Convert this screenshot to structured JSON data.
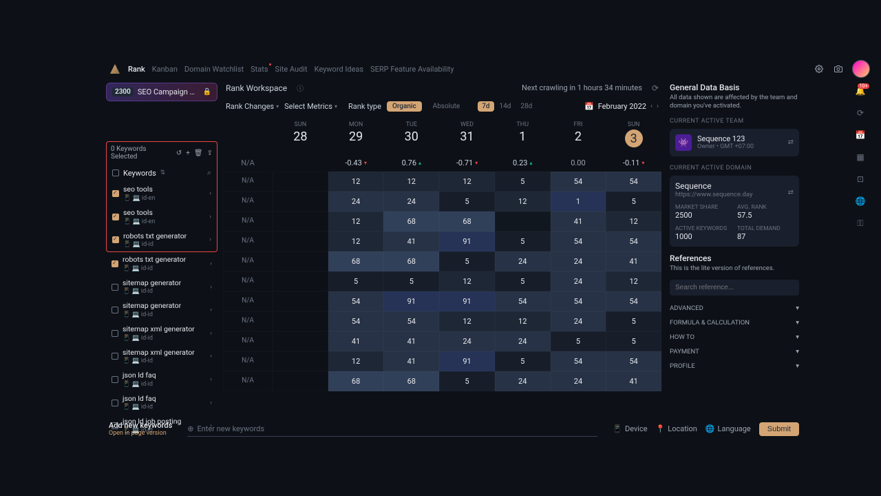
{
  "nav": {
    "items": [
      "Rank",
      "Kanban",
      "Domain Watchlist",
      "Stats",
      "Site Audit",
      "Keyword Ideas",
      "SERP Feature Availability"
    ],
    "active": 0
  },
  "project": {
    "count": "2300",
    "name": "SEO Campaign M.."
  },
  "kw_panel": {
    "selected_label": "0 Keywords Selected",
    "header": "Keywords",
    "items": [
      {
        "name": "seo tools",
        "meta": "id-en",
        "checked": true
      },
      {
        "name": "seo tools",
        "meta": "id-en",
        "checked": true
      },
      {
        "name": "robots txt generator",
        "meta": "id-id",
        "checked": true
      },
      {
        "name": "robots txt generator",
        "meta": "id-id",
        "checked": true
      },
      {
        "name": "sitemap generator",
        "meta": "id-id",
        "checked": false
      },
      {
        "name": "sitemap generator",
        "meta": "id-id",
        "checked": false
      },
      {
        "name": "sitemap xml generator",
        "meta": "id-id",
        "checked": false
      },
      {
        "name": "sitemap xml generator",
        "meta": "id-id",
        "checked": false
      },
      {
        "name": "json ld faq",
        "meta": "id-id",
        "checked": false
      },
      {
        "name": "json ld faq",
        "meta": "id-id",
        "checked": false
      },
      {
        "name": "json ld job posting",
        "meta": "id-id",
        "checked": false
      }
    ]
  },
  "workspace": {
    "label": "Rank Workspace",
    "crawl": "Next crawling in 1 hours 34 minutes"
  },
  "filters": {
    "rank_changes": "Rank Changes",
    "select_metrics": "Select Metrics",
    "rank_type_label": "Rank type",
    "organic": "Organic",
    "absolute": "Absolute",
    "ranges": [
      "7d",
      "14d",
      "28d"
    ],
    "date": "February 2022"
  },
  "calendar": {
    "days": [
      {
        "dow": "SUN",
        "dom": "28"
      },
      {
        "dow": "MON",
        "dom": "29"
      },
      {
        "dow": "TUE",
        "dom": "30"
      },
      {
        "dow": "WED",
        "dom": "31"
      },
      {
        "dow": "THU",
        "dom": "1"
      },
      {
        "dow": "FRI",
        "dom": "2"
      },
      {
        "dow": "SUN",
        "dom": "3",
        "highlight": true
      }
    ],
    "na": "N/A",
    "changes": [
      {
        "val": "-0.43",
        "dir": "down"
      },
      {
        "val": "0.76",
        "dir": "up"
      },
      {
        "val": "-0.71",
        "dir": "down"
      },
      {
        "val": "0.23",
        "dir": "up"
      },
      {
        "val": "0.00",
        "dir": "none"
      },
      {
        "val": "-0.11",
        "dir": "down"
      }
    ],
    "rows": [
      {
        "na": "N/A",
        "cells": [
          {
            "v": "12",
            "d": 2
          },
          {
            "v": "12",
            "d": 2
          },
          {
            "v": "12",
            "d": 2
          },
          {
            "v": "5",
            "d": 1
          },
          {
            "v": "54",
            "d": 3
          },
          {
            "v": "54",
            "d": 3
          }
        ]
      },
      {
        "na": "N/A",
        "cells": [
          {
            "v": "24",
            "d": 3
          },
          {
            "v": "24",
            "d": 3
          },
          {
            "v": "5",
            "d": 1
          },
          {
            "v": "12",
            "d": 2
          },
          {
            "v": "1",
            "d": 5
          },
          {
            "v": "5",
            "d": 1
          }
        ]
      },
      {
        "na": "N/A",
        "cells": [
          {
            "v": "12",
            "d": 2
          },
          {
            "v": "68",
            "d": 4
          },
          {
            "v": "68",
            "d": 4
          },
          {
            "v": "",
            "d": 0
          },
          {
            "v": "41",
            "d": 3
          },
          {
            "v": "12",
            "d": 2
          }
        ]
      },
      {
        "na": "N/A",
        "cells": [
          {
            "v": "12",
            "d": 2
          },
          {
            "v": "41",
            "d": 3
          },
          {
            "v": "91",
            "d": 5
          },
          {
            "v": "5",
            "d": 1
          },
          {
            "v": "54",
            "d": 3
          },
          {
            "v": "54",
            "d": 3
          }
        ]
      },
      {
        "na": "N/A",
        "cells": [
          {
            "v": "68",
            "d": 4
          },
          {
            "v": "68",
            "d": 4
          },
          {
            "v": "5",
            "d": 1
          },
          {
            "v": "24",
            "d": 3
          },
          {
            "v": "24",
            "d": 3
          },
          {
            "v": "41",
            "d": 3
          }
        ]
      },
      {
        "na": "N/A",
        "cells": [
          {
            "v": "5",
            "d": 1
          },
          {
            "v": "5",
            "d": 1
          },
          {
            "v": "12",
            "d": 2
          },
          {
            "v": "5",
            "d": 1
          },
          {
            "v": "24",
            "d": 3
          },
          {
            "v": "12",
            "d": 2
          }
        ]
      },
      {
        "na": "N/A",
        "cells": [
          {
            "v": "54",
            "d": 3
          },
          {
            "v": "91",
            "d": 5
          },
          {
            "v": "91",
            "d": 5
          },
          {
            "v": "54",
            "d": 3
          },
          {
            "v": "54",
            "d": 3
          },
          {
            "v": "54",
            "d": 3
          }
        ]
      },
      {
        "na": "N/A",
        "cells": [
          {
            "v": "54",
            "d": 3
          },
          {
            "v": "54",
            "d": 3
          },
          {
            "v": "12",
            "d": 2
          },
          {
            "v": "12",
            "d": 2
          },
          {
            "v": "24",
            "d": 3
          },
          {
            "v": "5",
            "d": 1
          }
        ]
      },
      {
        "na": "N/A",
        "cells": [
          {
            "v": "41",
            "d": 3
          },
          {
            "v": "41",
            "d": 3
          },
          {
            "v": "24",
            "d": 3
          },
          {
            "v": "24",
            "d": 3
          },
          {
            "v": "5",
            "d": 1
          },
          {
            "v": "5",
            "d": 1
          }
        ]
      },
      {
        "na": "N/A",
        "cells": [
          {
            "v": "12",
            "d": 2
          },
          {
            "v": "41",
            "d": 3
          },
          {
            "v": "91",
            "d": 5
          },
          {
            "v": "5",
            "d": 1
          },
          {
            "v": "54",
            "d": 3
          },
          {
            "v": "54",
            "d": 3
          }
        ]
      },
      {
        "na": "N/A",
        "cells": [
          {
            "v": "68",
            "d": 4
          },
          {
            "v": "68",
            "d": 4
          },
          {
            "v": "5",
            "d": 1
          },
          {
            "v": "24",
            "d": 3
          },
          {
            "v": "24",
            "d": 3
          },
          {
            "v": "41",
            "d": 3
          }
        ]
      }
    ]
  },
  "right": {
    "basis_title": "General Data Basis",
    "basis_sub": "All data shown are affected by the team and domain you've activated.",
    "team_label": "CURRENT ACTIVE TEAM",
    "team_name": "Sequence 123",
    "team_meta": "Owner • GMT +07:00",
    "domain_label": "CURRENT ACTIVE DOMAIN",
    "domain_name": "Sequence",
    "domain_url": "https://www.sequence.day",
    "metrics": {
      "market_share_label": "MARKET SHARE",
      "market_share": "2500",
      "avg_rank_label": "AVG. RANK",
      "avg_rank": "57.5",
      "active_kw_label": "ACTIVE KEYWORDS",
      "active_kw": "1000",
      "total_demand_label": "TOTAL DEMAND",
      "total_demand": "87"
    },
    "ref_title": "References",
    "ref_sub": "This is the lite version of references.",
    "ref_placeholder": "Search reference...",
    "accordion": [
      "ADVANCED",
      "FORMULA & CALCULATION",
      "HOW TO",
      "PAYMENT",
      "PROFILE"
    ]
  },
  "bottom": {
    "add_title": "Add new keywords",
    "add_sub": "Open in page version",
    "enter_placeholder": "Enter new keywords",
    "device": "Device",
    "location": "Location",
    "language": "Language",
    "submit": "Submit"
  },
  "notif": "10+"
}
